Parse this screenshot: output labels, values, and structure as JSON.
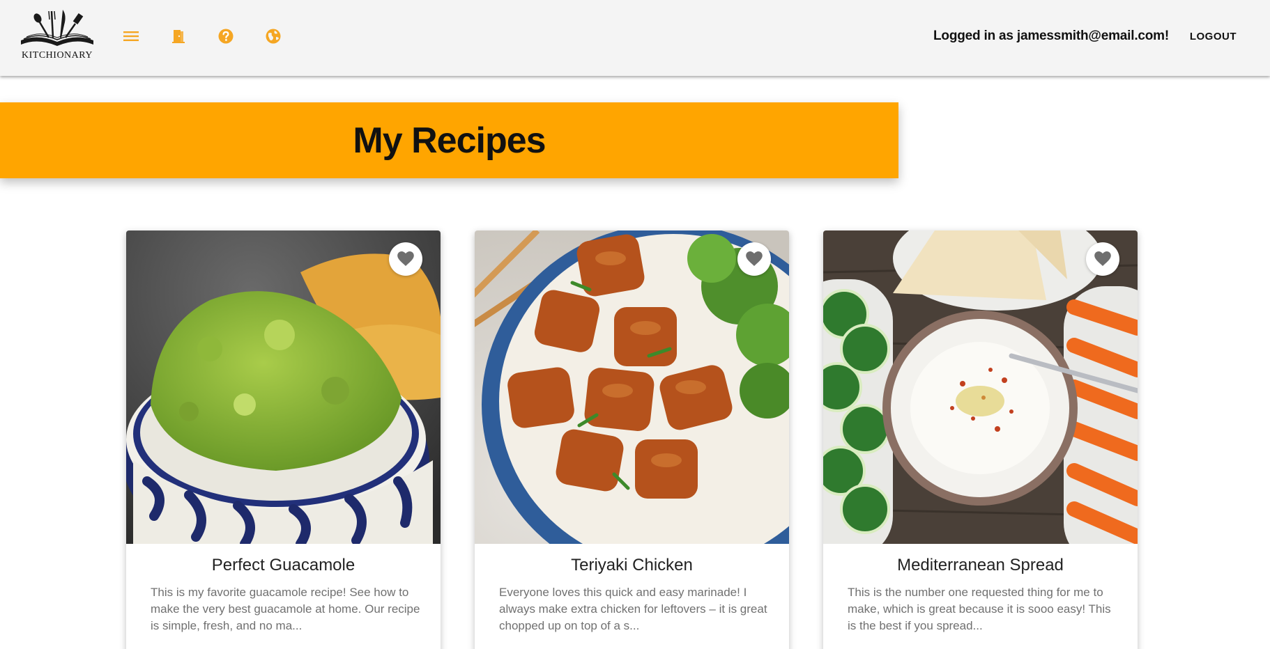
{
  "header": {
    "logo_text": "KITCHIONARY",
    "nav_icons": [
      "menu-icon",
      "door-icon",
      "help-icon",
      "globe-icon"
    ],
    "user_text": "Logged in as jamessmith@email.com!",
    "logout_label": "LOGOUT"
  },
  "colors": {
    "accent": "#ffa500",
    "header_bg": "#f4f4f4",
    "icon": "#f5a623"
  },
  "banner": {
    "title": "My Recipes"
  },
  "recipes": [
    {
      "title": "Perfect Guacamole",
      "description": "This is my favorite guacamole recipe! See how to make the very best guacamole at home. Our recipe is simple, fresh, and no ma...",
      "icon": "heart-icon"
    },
    {
      "title": "Teriyaki Chicken",
      "description": "Everyone loves this quick and easy marinade! I always make extra chicken for leftovers – it is great chopped up on top of a s...",
      "icon": "heart-icon"
    },
    {
      "title": "Mediterranean Spread",
      "description": "This is the number one requested thing for me to make, which is great because it is sooo easy! This is the best if you spread...",
      "icon": "heart-icon"
    }
  ]
}
